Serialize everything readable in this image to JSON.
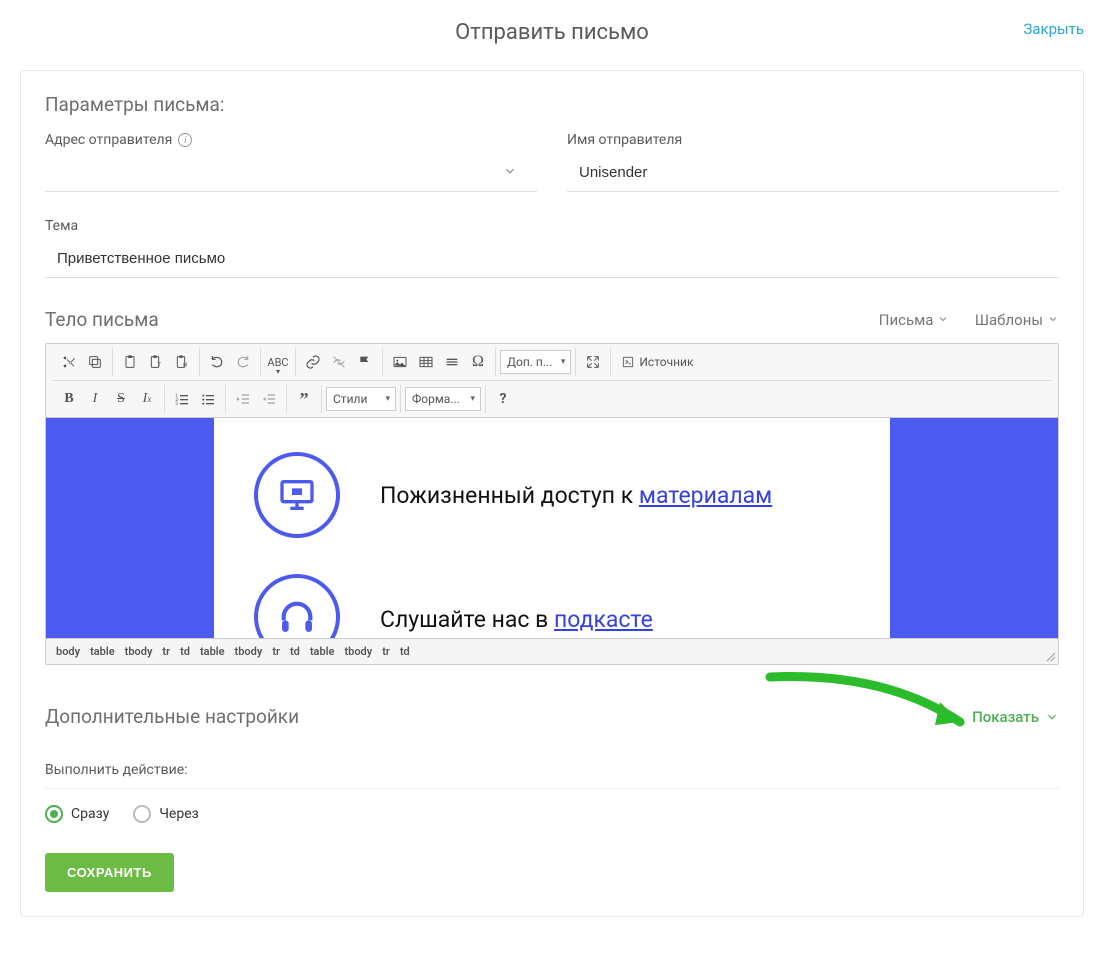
{
  "header": {
    "title": "Отправить письмо",
    "close": "Закрыть"
  },
  "params": {
    "section_title": "Параметры письма:",
    "sender_address_label": "Адрес отправителя",
    "sender_address_value": "",
    "sender_name_label": "Имя отправителя",
    "sender_name_value": "Unisender",
    "subject_label": "Тема",
    "subject_value": "Приветственное письмо"
  },
  "body": {
    "section_title": "Тело письма",
    "dropdowns": {
      "letters": "Письма",
      "templates": "Шаблоны"
    }
  },
  "toolbar": {
    "additional": "Доп. п...",
    "source": "Источник",
    "styles": "Стили",
    "format": "Форма...",
    "icons": {
      "cut": "cut",
      "copy": "copy",
      "paste": "paste",
      "paste_text": "paste-text",
      "paste_word": "paste-word",
      "undo": "undo",
      "redo": "redo",
      "spellcheck": "spellcheck",
      "link": "link",
      "unlink": "unlink",
      "flag": "flag",
      "image": "image",
      "table": "table",
      "hr": "hr",
      "special": "special",
      "maximize": "maximize",
      "bold": "B",
      "italic": "I",
      "strike": "S",
      "clear": "clear-format",
      "ol": "ol",
      "ul": "ul",
      "outdent": "outdent",
      "indent": "indent",
      "quote": "quote",
      "help": "?"
    }
  },
  "preview": {
    "line1_text": "Пожизненный доступ к ",
    "line1_link": "материалам",
    "line2_text": "Слушайте нас в ",
    "line2_link": "подкасте"
  },
  "elements_path": [
    "body",
    "table",
    "tbody",
    "tr",
    "td",
    "table",
    "tbody",
    "tr",
    "td",
    "table",
    "tbody",
    "tr",
    "td"
  ],
  "additional": {
    "section_title": "Дополнительные настройки",
    "show": "Показать"
  },
  "action": {
    "label": "Выполнить действие:",
    "now": "Сразу",
    "after": "Через"
  },
  "buttons": {
    "save": "СОХРАНИТЬ"
  }
}
